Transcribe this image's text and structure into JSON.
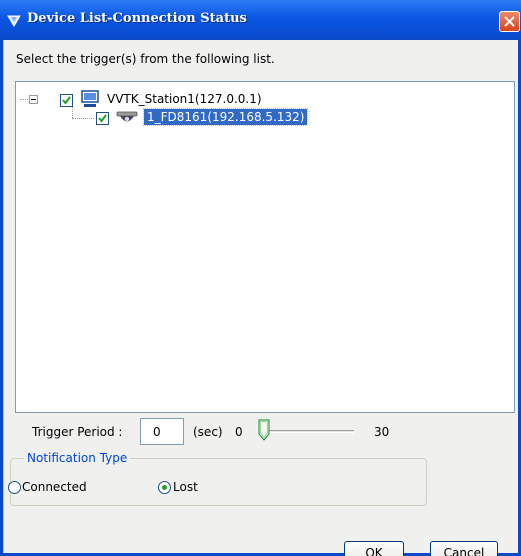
{
  "window": {
    "title": "Device List-Connection Status"
  },
  "instruction": "Select the trigger(s) from the following list.",
  "tree": {
    "station": {
      "label": "VVTK_Station1(127.0.0.1)",
      "checked": true,
      "expanded": true,
      "icon": "computer-icon"
    },
    "device": {
      "label": "1_FD8161(192.168.5.132)",
      "checked": true,
      "selected": true,
      "icon": "dome-camera-icon"
    }
  },
  "trigger": {
    "label": "Trigger Period :",
    "value": "0",
    "unit": "(sec)",
    "slider_min": "0",
    "slider_max": "30",
    "slider_value": 0
  },
  "notification": {
    "legend": "Notification Type",
    "options": [
      {
        "label": "Connected",
        "checked": false
      },
      {
        "label": "Lost",
        "checked": true
      }
    ]
  },
  "buttons": {
    "ok": "OK",
    "cancel": "Cancel"
  },
  "colors": {
    "titlebar": "#0b56e3",
    "selection": "#316ac5",
    "group_legend": "#0046d5",
    "radio_dot": "#21a121",
    "close": "#d9421b"
  }
}
